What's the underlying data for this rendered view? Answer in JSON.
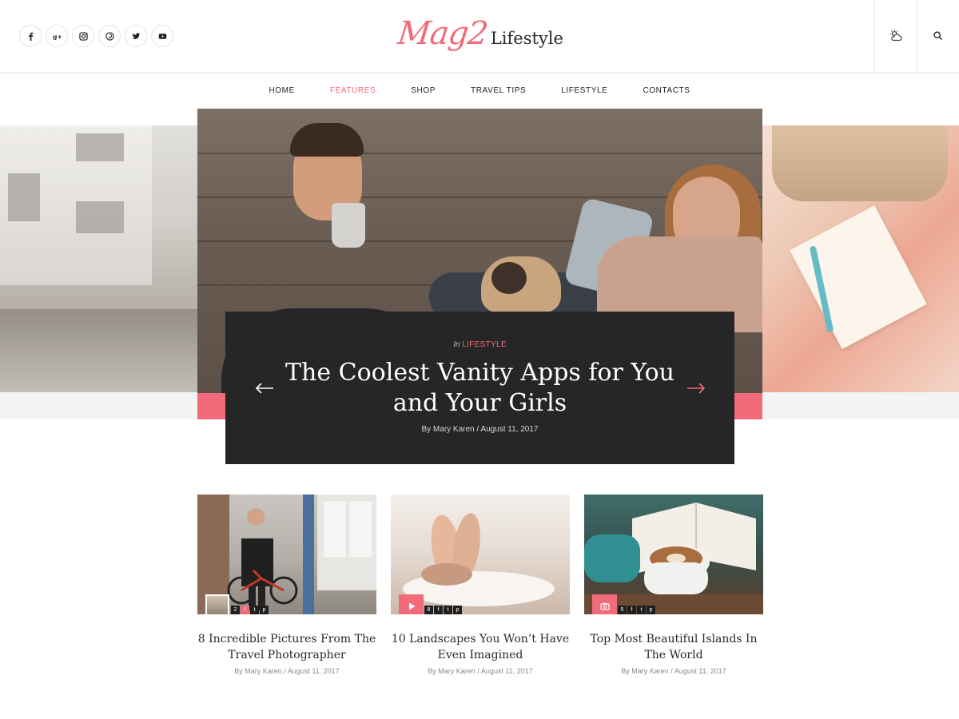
{
  "header": {
    "logo_script": "Mag2",
    "logo_word": "Lifestyle",
    "social": [
      {
        "icon": "facebook-icon",
        "glyph": "f"
      },
      {
        "icon": "google-plus-icon",
        "glyph": "g+"
      },
      {
        "icon": "instagram-icon",
        "glyph": ""
      },
      {
        "icon": "pinterest-icon",
        "glyph": ""
      },
      {
        "icon": "twitter-icon",
        "glyph": ""
      },
      {
        "icon": "youtube-icon",
        "glyph": ""
      }
    ],
    "tools": [
      "weather-icon",
      "search-icon"
    ]
  },
  "nav": {
    "items": [
      "HOME",
      "FEATURES",
      "SHOP",
      "TRAVEL TIPS",
      "LIFESTYLE",
      "CONTACTS"
    ],
    "active": "FEATURES"
  },
  "slider": {
    "in_label": "In",
    "category": "LIFESTYLE",
    "title": "The Coolest Vanity Apps for You and Your Girls",
    "meta": "By Mary Karen / August 11, 2017",
    "prev_icon": "arrow-left-icon",
    "next_icon": "arrow-right-icon"
  },
  "cards": [
    {
      "title": "8 Incredible Pictures From The Travel Photographer",
      "meta": "By Mary Karen / August 11, 2017",
      "badge": "author-thumbnail",
      "share_count": "2",
      "share_icons": [
        "facebook-icon",
        "twitter-icon",
        "pinterest-icon"
      ]
    },
    {
      "title": "10 Landscapes You Won’t Have Even Imagined",
      "meta": "By Mary Karen / August 11, 2017",
      "badge": "play-icon",
      "share_count": "8",
      "share_icons": [
        "facebook-icon",
        "twitter-icon",
        "pinterest-icon"
      ]
    },
    {
      "title": "Top Most Beautiful Islands In The World",
      "meta": "By Mary Karen / August 11, 2017",
      "badge": "camera-icon",
      "share_count": "5",
      "share_icons": [
        "facebook-icon",
        "twitter-icon",
        "pinterest-icon"
      ]
    }
  ],
  "colors": {
    "accent": "#f26b7a",
    "caption_bg": "#262626",
    "text_dark": "#2a2a2a",
    "meta_gray": "#8a8a8a"
  }
}
